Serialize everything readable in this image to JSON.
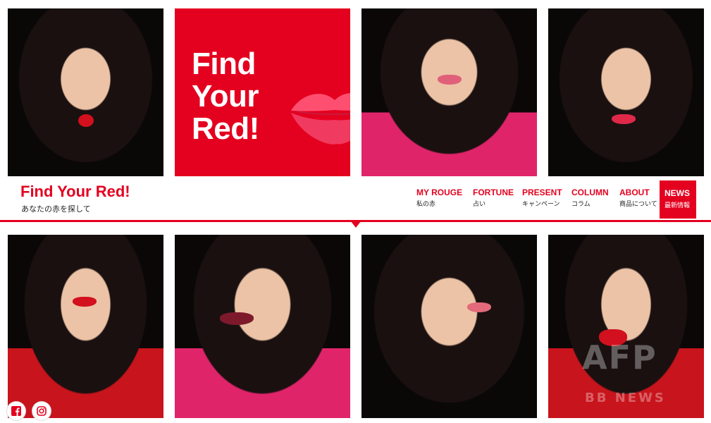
{
  "hero": {
    "title": "Find\nYour\nRed!"
  },
  "brand": {
    "logo": "Find Your Red!",
    "tagline": "あなたの赤を探して"
  },
  "nav": [
    {
      "label": "MY ROUGE",
      "sub": "私の赤"
    },
    {
      "label": "FORTUNE",
      "sub": "占い"
    },
    {
      "label": "PRESENT",
      "sub": "キャンペーン"
    },
    {
      "label": "COLUMN",
      "sub": "コラム"
    },
    {
      "label": "ABOUT",
      "sub": "商品について"
    }
  ],
  "nav_active": {
    "label": "NEWS",
    "sub": "最新情報"
  },
  "social": {
    "facebook_icon": "facebook-icon",
    "instagram_icon": "instagram-icon"
  },
  "watermark": {
    "top": "AFP",
    "bottom": "BB NEWS"
  },
  "colors": {
    "accent": "#e4001f",
    "background": "#ffffff",
    "photo_bg": "#0a0707"
  }
}
